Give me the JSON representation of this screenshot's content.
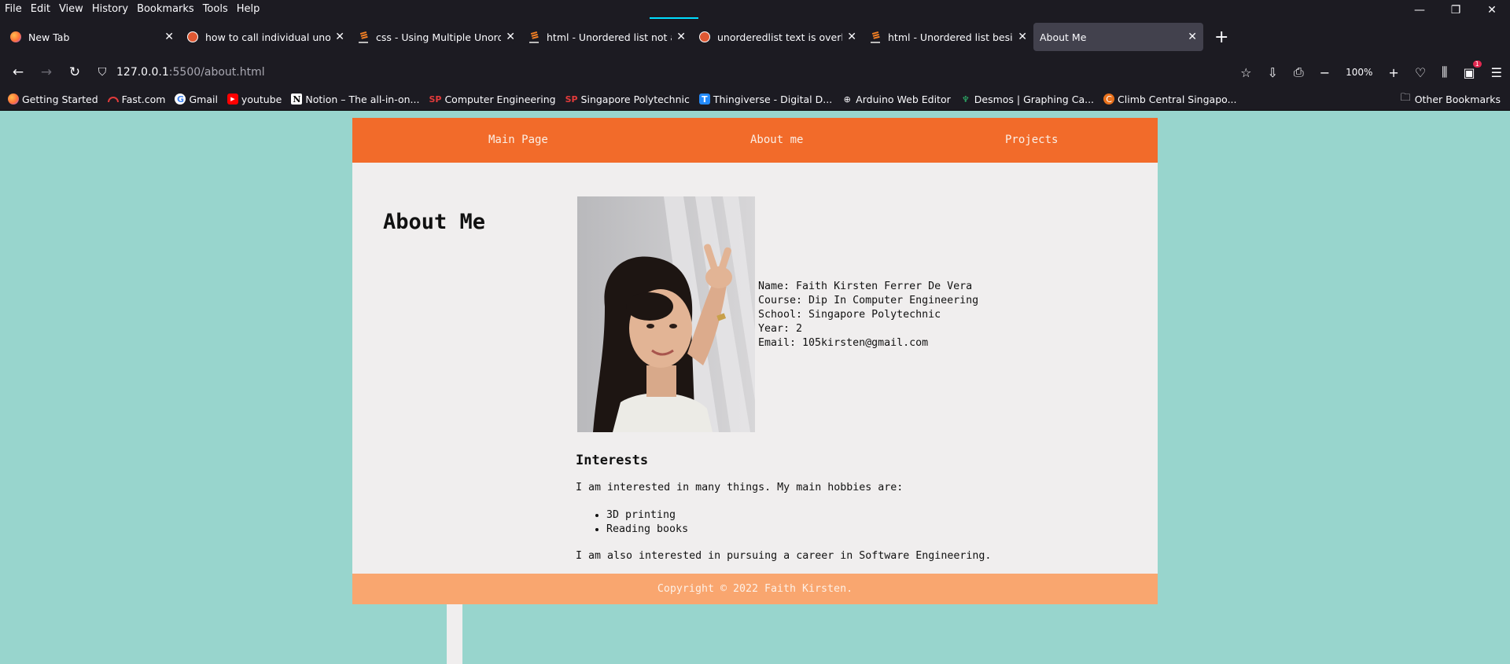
{
  "menubar": {
    "items": [
      "File",
      "Edit",
      "View",
      "History",
      "Bookmarks",
      "Tools",
      "Help"
    ]
  },
  "window_controls": {
    "minimize": "—",
    "restore": "❐",
    "close": "✕"
  },
  "tabs": [
    {
      "title": "New Tab",
      "icon": "firefox-icon"
    },
    {
      "title": "how to call individual unordered",
      "icon": "duckduckgo-icon"
    },
    {
      "title": "css - Using Multiple Unordered L",
      "icon": "stackoverflow-icon"
    },
    {
      "title": "html - Unordered list not aligning",
      "icon": "stackoverflow-icon"
    },
    {
      "title": "unorderedlist text is overlapping",
      "icon": "duckduckgo-icon"
    },
    {
      "title": "html - Unordered list beside para",
      "icon": "stackoverflow-icon"
    },
    {
      "title": "About Me",
      "icon": "",
      "active": true
    }
  ],
  "navbar": {
    "url_host": "127.0.0.1",
    "url_path": ":5500/about.html",
    "zoom": "100%",
    "notification_count": "1"
  },
  "bookmarks": [
    {
      "label": "Getting Started",
      "icon": "firefox-icon"
    },
    {
      "label": "Fast.com",
      "icon": "fast-icon"
    },
    {
      "label": "Gmail",
      "icon": "google-icon"
    },
    {
      "label": "youtube",
      "icon": "youtube-icon"
    },
    {
      "label": "Notion – The all-in-on...",
      "icon": "notion-icon"
    },
    {
      "label": "Computer Engineering",
      "icon": "sp-icon"
    },
    {
      "label": "Singapore Polytechnic",
      "icon": "sp-icon"
    },
    {
      "label": "Thingiverse - Digital D...",
      "icon": "thingiverse-icon"
    },
    {
      "label": "Arduino Web Editor",
      "icon": "globe-icon"
    },
    {
      "label": "Desmos | Graphing Ca...",
      "icon": "desmos-icon"
    },
    {
      "label": "Climb Central Singapo...",
      "icon": "climb-central-icon"
    }
  ],
  "other_bookmarks": "Other Bookmarks",
  "site": {
    "nav": [
      "Main Page",
      "About me",
      "Projects"
    ],
    "heading": "About Me",
    "info": [
      "Name: Faith Kirsten Ferrer De Vera",
      "Course: Dip In Computer Engineering",
      "School: Singapore Polytechnic",
      "Year: 2",
      "Email: 105kirsten@gmail.com"
    ],
    "interests_heading": "Interests",
    "interests_intro": "I am interested in many things. My main hobbies are:",
    "hobbies": [
      "3D printing",
      "Reading books"
    ],
    "interests_outro": "I am also interested in pursuing a career in Software Engineering.",
    "footer": "Copyright © 2022 Faith Kirsten."
  },
  "colors": {
    "page_bg": "#98d5cd",
    "nav_bg": "#f26b2a",
    "footer_bg": "#f9a66f",
    "content_bg": "#f0eeee"
  }
}
